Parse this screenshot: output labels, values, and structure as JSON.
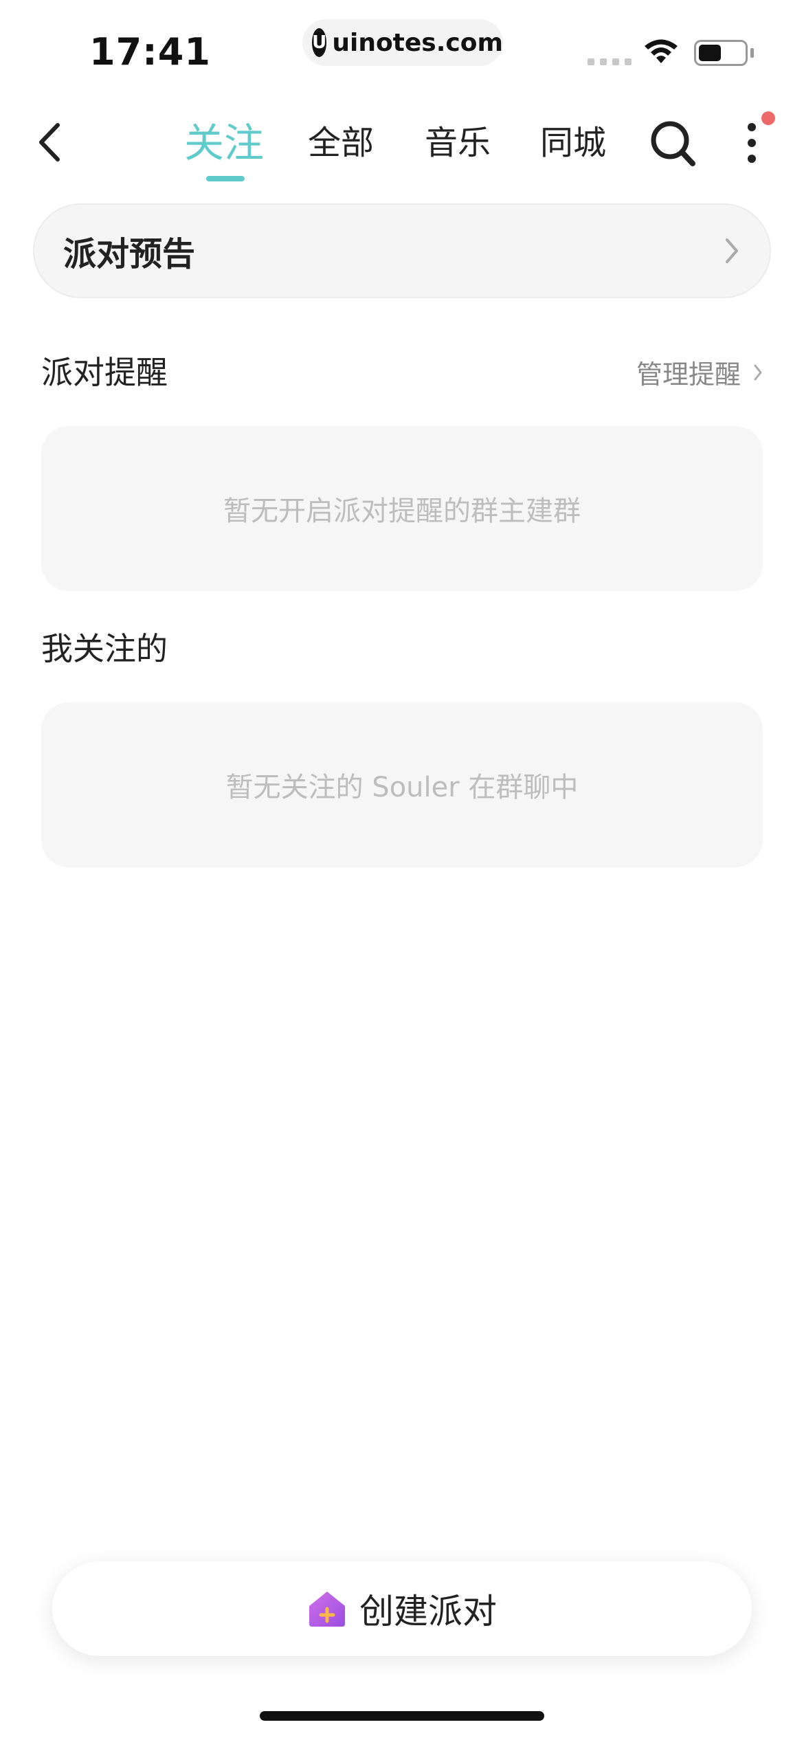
{
  "status_bar": {
    "time": "17:41",
    "url_logo": "U",
    "url": "uinotes.com"
  },
  "nav": {
    "tabs": [
      {
        "label": "关注",
        "active": true
      },
      {
        "label": "全部",
        "active": false
      },
      {
        "label": "音乐",
        "active": false
      },
      {
        "label": "同城",
        "active": false
      }
    ],
    "icons": {
      "back": "chevron-left-icon",
      "search": "search-icon",
      "more": "more-vertical-icon",
      "notification": "red-dot-badge"
    },
    "accent_color": "#5fcbcb",
    "badge_color": "#ee6a6a"
  },
  "preview": {
    "title": "派对预告"
  },
  "reminders": {
    "title": "派对提醒",
    "manage_label": "管理提醒",
    "empty_text": "暂无开启派对提醒的群主建群"
  },
  "following": {
    "title": "我关注的",
    "empty_text": "暂无关注的 Souler 在群聊中"
  },
  "create": {
    "label": "创建派对",
    "icon": "house-plus-icon"
  }
}
